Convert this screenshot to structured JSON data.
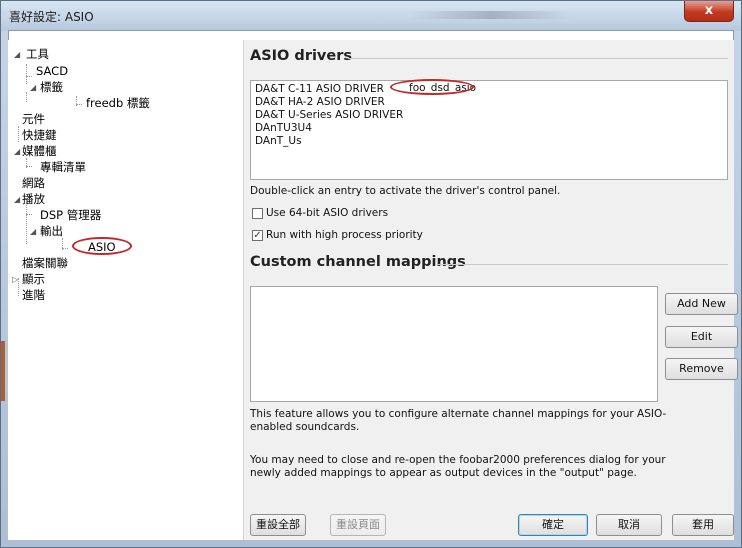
{
  "window": {
    "title": "喜好設定: ASIO",
    "close_glyph": "x"
  },
  "tree": {
    "items": [
      {
        "label": "工具",
        "arrow": "◢"
      },
      {
        "label": "SACD"
      },
      {
        "label": "標籤",
        "arrow": "◢"
      },
      {
        "label": "freedb 標籤"
      },
      {
        "label": "元件"
      },
      {
        "label": "快捷鍵"
      },
      {
        "label": "媒體櫃",
        "arrow": "◢"
      },
      {
        "label": "專輯清單"
      },
      {
        "label": "網路"
      },
      {
        "label": "播放",
        "arrow": "◢"
      },
      {
        "label": "DSP 管理器"
      },
      {
        "label": "輸出",
        "arrow": "◢"
      },
      {
        "label": "ASIO"
      },
      {
        "label": "檔案關聯"
      },
      {
        "label": "顯示",
        "arrow": "▷"
      },
      {
        "label": "進階"
      }
    ]
  },
  "asio_drivers": {
    "heading": "ASIO drivers",
    "drivers": [
      "DA&T C-11 ASIO DRIVER",
      "DA&T HA-2 ASIO DRIVER",
      "DA&T U-Series ASIO DRIVER",
      "DAnTU3U4",
      "DAnT_Us"
    ],
    "extra_entry": "foo_dsd_asio",
    "hint": "Double-click an entry to activate the driver's control panel.",
    "options": [
      {
        "label": "Use 64-bit ASIO drivers",
        "checked": false
      },
      {
        "label": "Run with high process priority",
        "checked": true
      }
    ]
  },
  "mappings": {
    "heading": "Custom channel mappings",
    "add_label": "Add New",
    "edit_label": "Edit",
    "remove_label": "Remove",
    "note1": "This feature allows you to configure alternate channel mappings for your ASIO-enabled soundcards.",
    "note2": "You may need to close and re-open the foobar2000 preferences dialog for your newly added mappings to appear as output devices in the \"output\" page."
  },
  "footer": {
    "reset_all": "重設全部",
    "reset_page": "重設頁面",
    "ok": "確定",
    "cancel": "取消",
    "apply": "套用"
  },
  "colors": {
    "annotation": "#c0282a",
    "close_button": "#c23a22"
  }
}
